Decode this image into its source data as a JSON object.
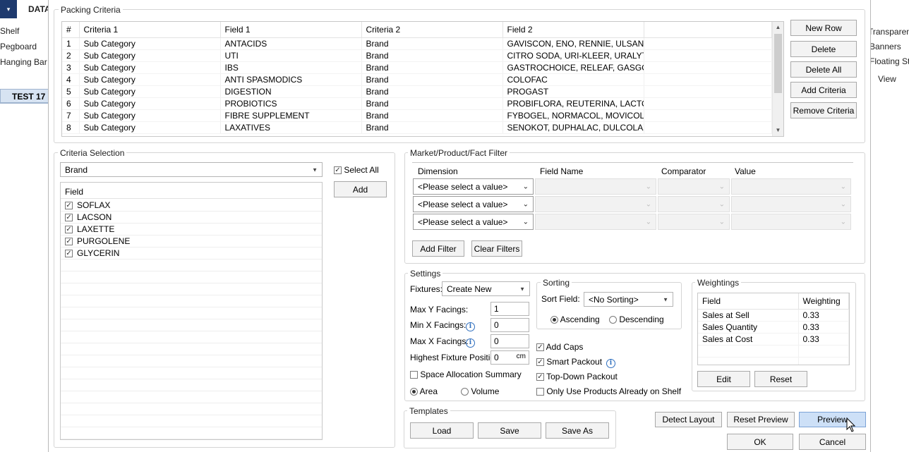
{
  "background_app": {
    "menu_label": "DATA",
    "left_items": [
      "Shelf",
      "Pegboard",
      "Hanging Bar"
    ],
    "right_items": [
      "Transparent",
      "Banners",
      "Floating Sta",
      "View"
    ],
    "tab_label": "TEST 17"
  },
  "packing_criteria": {
    "title": "Packing Criteria",
    "columns": [
      "#",
      "Criteria 1",
      "Field 1",
      "Criteria 2",
      "Field 2"
    ],
    "rows": [
      [
        "1",
        "Sub Category",
        "ANTACIDS",
        "Brand",
        "GAVISCON, ENO, RENNIE, ULSANI..."
      ],
      [
        "2",
        "Sub Category",
        "UTI",
        "Brand",
        "CITRO SODA, URI-KLEER, URALYT..."
      ],
      [
        "3",
        "Sub Category",
        "IBS",
        "Brand",
        "GASTROCHOICE, RELEAF, GASGO..."
      ],
      [
        "4",
        "Sub Category",
        "ANTI SPASMODICS",
        "Brand",
        "COLOFAC"
      ],
      [
        "5",
        "Sub Category",
        "DIGESTION",
        "Brand",
        "PROGAST"
      ],
      [
        "6",
        "Sub Category",
        "PROBIOTICS",
        "Brand",
        "PROBIFLORA, REUTERINA, LACTO..."
      ],
      [
        "7",
        "Sub Category",
        "FIBRE SUPPLEMENT",
        "Brand",
        "FYBOGEL, NORMACOL, MOVICOL"
      ],
      [
        "8",
        "Sub Category",
        "LAXATIVES",
        "Brand",
        "SENOKOT, DUPHALAC, DULCOLAX..."
      ]
    ],
    "buttons": {
      "new_row": "New Row",
      "delete": "Delete",
      "delete_all": "Delete All",
      "add_criteria": "Add Criteria",
      "remove_criteria": "Remove Criteria"
    }
  },
  "criteria_selection": {
    "title": "Criteria Selection",
    "dropdown_value": "Brand",
    "select_all_label": "Select All",
    "add_label": "Add",
    "field_header": "Field",
    "fields": [
      "SOFLAX",
      "LACSON",
      "LAXETTE",
      "PURGOLENE",
      "GLYCERIN"
    ]
  },
  "filter": {
    "title": "Market/Product/Fact Filter",
    "columns": [
      "Dimension",
      "Field Name",
      "Comparator",
      "Value"
    ],
    "dimension_placeholder": "<Please select a value>",
    "add_filter": "Add Filter",
    "clear_filters": "Clear Filters"
  },
  "settings": {
    "title": "Settings",
    "fixtures_label": "Fixtures:",
    "fixtures_value": "Create New",
    "max_y_label": "Max Y Facings:",
    "max_y_value": "1",
    "min_x_label": "Min X Facings:",
    "min_x_value": "0",
    "max_x_label": "Max X Facings:",
    "max_x_value": "0",
    "highest_label": "Highest Fixture Position:",
    "highest_value": "0",
    "highest_unit": "cm",
    "space_summary_label": "Space Allocation Summary",
    "area_label": "Area",
    "volume_label": "Volume",
    "add_caps_label": "Add Caps",
    "smart_packout_label": "Smart Packout",
    "top_down_label": "Top-Down Packout",
    "only_use_label": "Only Use Products Already on Shelf"
  },
  "sorting": {
    "title": "Sorting",
    "sort_field_label": "Sort Field:",
    "sort_field_value": "<No Sorting>",
    "ascending_label": "Ascending",
    "descending_label": "Descending"
  },
  "weightings": {
    "title": "Weightings",
    "columns": [
      "Field",
      "Weighting"
    ],
    "rows": [
      [
        "Sales at Sell",
        "0.33"
      ],
      [
        "Sales Quantity",
        "0.33"
      ],
      [
        "Sales at Cost",
        "0.33"
      ]
    ],
    "edit_label": "Edit",
    "reset_label": "Reset"
  },
  "templates": {
    "title": "Templates",
    "load_label": "Load",
    "save_label": "Save",
    "save_as_label": "Save As"
  },
  "footer": {
    "detect_layout": "Detect Layout",
    "reset_preview": "Reset Preview",
    "preview": "Preview",
    "ok": "OK",
    "cancel": "Cancel"
  }
}
